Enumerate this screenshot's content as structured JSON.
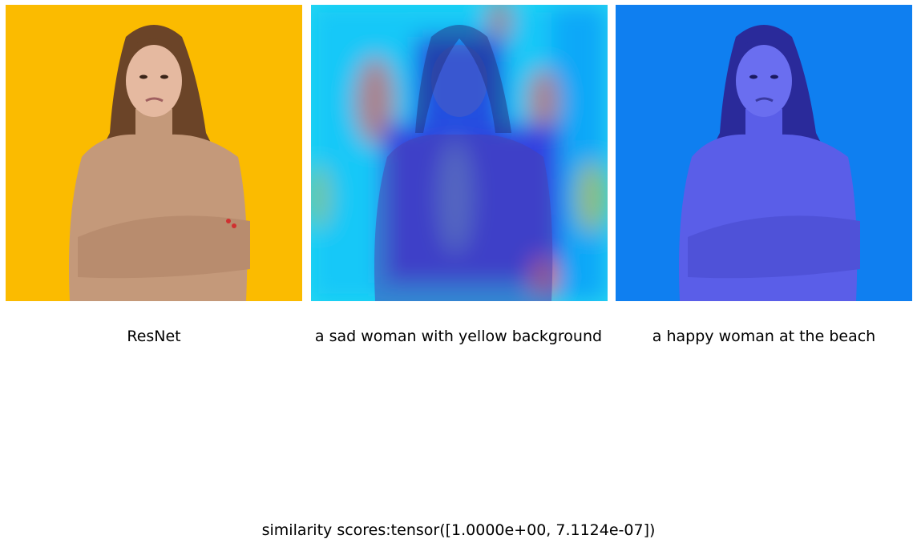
{
  "panels": [
    {
      "caption": "ResNet",
      "kind": "original"
    },
    {
      "caption": "a sad woman with yellow background",
      "kind": "heatmap"
    },
    {
      "caption": "a happy woman at the beach",
      "kind": "tinted"
    }
  ],
  "footer": "similarity scores:tensor([1.0000e+00, 7.1124e-07])",
  "colors": {
    "background_original": "#fbbb00",
    "background_tinted": "#0f7ff0",
    "sweater": "#c4997a",
    "hair": "#6b4428",
    "skin": "#e5b9a0"
  }
}
